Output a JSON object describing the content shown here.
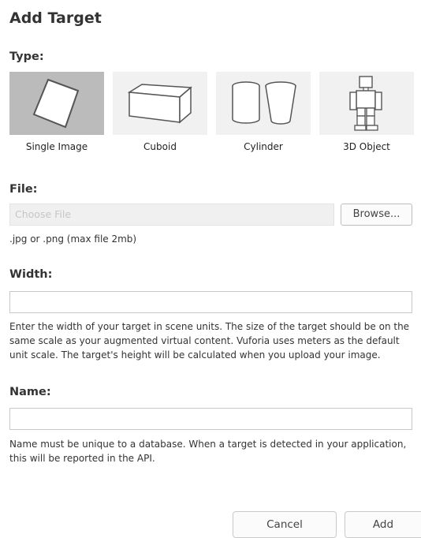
{
  "dialog": {
    "title": "Add Target"
  },
  "type_section": {
    "label": "Type:",
    "selected": "Single Image",
    "options": [
      {
        "label": "Single Image",
        "icon": "single-image-icon"
      },
      {
        "label": "Cuboid",
        "icon": "cuboid-icon"
      },
      {
        "label": "Cylinder",
        "icon": "cylinder-icon"
      },
      {
        "label": "3D Object",
        "icon": "3d-object-icon"
      }
    ]
  },
  "file_section": {
    "label": "File:",
    "placeholder": "Choose File",
    "browse_label": "Browse...",
    "hint": ".jpg or .png (max file 2mb)"
  },
  "width_section": {
    "label": "Width:",
    "value": "",
    "help_lines": [
      "Enter the width of your target in scene units. The size of the target should be on the",
      "same scale as your augmented virtual content. Vuforia uses meters as the default",
      "unit scale. The target's height will be calculated when you upload your image."
    ]
  },
  "name_section": {
    "label": "Name:",
    "value": "",
    "help_lines": [
      "Name must be unique to a database. When a target is detected in your application,",
      "this will be reported in the API."
    ]
  },
  "actions": {
    "cancel_label": "Cancel",
    "add_label": "Add"
  },
  "colors": {
    "tile_selected": "#bbbbbb",
    "tile_default": "#f1f1f1",
    "icon_stroke": "#555555"
  }
}
